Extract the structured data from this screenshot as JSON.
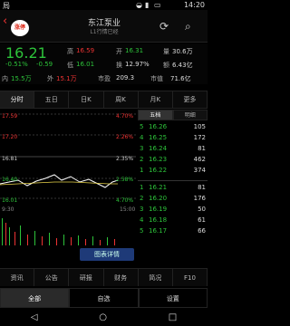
{
  "status": {
    "signal": "局",
    "time": "14:20",
    "icons": [
      "wifi-icon",
      "signal-icon",
      "battery-icon"
    ]
  },
  "header": {
    "back": "‹",
    "logo": "涨停",
    "title": "东江泵业",
    "subtitle": "L1行情已经",
    "icons": [
      "refresh-icon",
      "search-icon"
    ]
  },
  "quote": {
    "price": "16.21",
    "chg_pct": "-0.51%",
    "chg_abs": "-0.59",
    "hi_lbl": "高",
    "hi": "16.59",
    "lo_lbl": "低",
    "lo": "16.01",
    "open_lbl": "开",
    "open": "16.31",
    "turn_lbl": "换",
    "turn": "12.97%",
    "vol_lbl": "量",
    "vol": "30.6万",
    "amt_lbl": "额",
    "amt": "6.43亿",
    "in_lbl": "内",
    "in": "15.5万",
    "out_lbl": "外",
    "out": "15.1万",
    "pe_lbl": "市盈",
    "pe": "209.3",
    "mv_lbl": "市值",
    "mv": "71.6亿"
  },
  "tabs": [
    "分时",
    "五日",
    "日K",
    "周K",
    "月K",
    "更多"
  ],
  "chart_labels": {
    "p1": "17.59",
    "p2": "17.20",
    "p3": "16.81",
    "p4": "16.40",
    "p5": "16.01",
    "r1": "4.70%",
    "r2": "2.26%",
    "r3": "2.35%",
    "r4": "2.58%",
    "r5": "4.70%",
    "t1": "9:30",
    "t2": "15:00"
  },
  "side": {
    "tab1": "五档",
    "tab2": "明细"
  },
  "ticks": [
    {
      "l": "5",
      "p": "16.26",
      "v": "105"
    },
    {
      "l": "4",
      "p": "16.25",
      "v": "172"
    },
    {
      "l": "3",
      "p": "16.24",
      "v": "81"
    },
    {
      "l": "2",
      "p": "16.23",
      "v": "462"
    },
    {
      "l": "1",
      "p": "16.22",
      "v": "374"
    },
    {
      "l": "1",
      "p": "16.21",
      "v": "81"
    },
    {
      "l": "2",
      "p": "16.20",
      "v": "176"
    },
    {
      "l": "3",
      "p": "16.19",
      "v": "50"
    },
    {
      "l": "4",
      "p": "16.18",
      "v": "61"
    },
    {
      "l": "5",
      "p": "16.17",
      "v": "66"
    }
  ],
  "overlay": "图表详情",
  "bottom_tabs": [
    "资讯",
    "公告",
    "研报",
    "财务",
    "简况",
    "F10"
  ],
  "actions": [
    "全部",
    "自选",
    "设置"
  ],
  "nav": [
    "◁",
    "○",
    "□"
  ]
}
